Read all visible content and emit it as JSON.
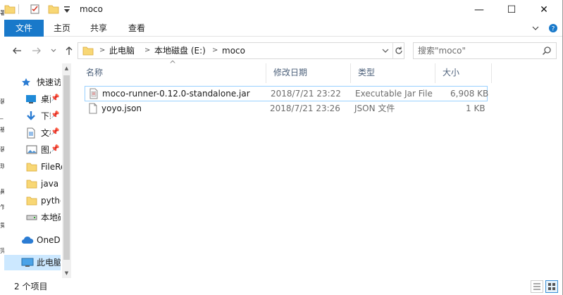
{
  "window": {
    "title": "moco",
    "minimize_glyph": "—",
    "maximize_glyph": "☐",
    "close_glyph": "✕"
  },
  "left_strip_fragments": [
    "暑",
    "装",
    "_",
    "被",
    "装",
    "现",
    "鼻",
    "乍",
    "竟",
    "完"
  ],
  "ribbon": {
    "tabs": [
      "文件",
      "主页",
      "共享",
      "查看"
    ]
  },
  "address": {
    "crumbs": [
      "此电脑",
      "本地磁盘 (E:)",
      "moco"
    ],
    "search_placeholder": "搜索\"moco\""
  },
  "nav": {
    "items": [
      {
        "label": "快速访问",
        "icon": "star-icon"
      },
      {
        "label": "桌面",
        "icon": "desktop-icon"
      },
      {
        "label": "下载",
        "icon": "download-icon"
      },
      {
        "label": "文档",
        "icon": "document-icon"
      },
      {
        "label": "图片",
        "icon": "picture-icon"
      },
      {
        "label": "FileRecv",
        "icon": "folder-icon"
      },
      {
        "label": "java",
        "icon": "folder-icon"
      },
      {
        "label": "python",
        "icon": "folder-icon"
      },
      {
        "label": "本地磁盘",
        "icon": "drive-icon"
      },
      {
        "label": "OneDrive",
        "icon": "cloud-icon"
      },
      {
        "label": "此电脑",
        "icon": "computer-icon"
      }
    ]
  },
  "columns": [
    "名称",
    "修改日期",
    "类型",
    "大小"
  ],
  "files": [
    {
      "name": "moco-runner-0.12.0-standalone.jar",
      "modified": "2018/7/21 23:22",
      "type": "Executable Jar File",
      "size": "6,908 KB",
      "icon": "jar-file-icon"
    },
    {
      "name": "yoyo.json",
      "modified": "2018/7/21 23:26",
      "type": "JSON 文件",
      "size": "1 KB",
      "icon": "json-file-icon"
    }
  ],
  "status": {
    "item_count": "2 个项目"
  },
  "colors": {
    "file_tab": "#1979ca",
    "selection": "#cce8ff",
    "header_text": "#4c607a"
  }
}
